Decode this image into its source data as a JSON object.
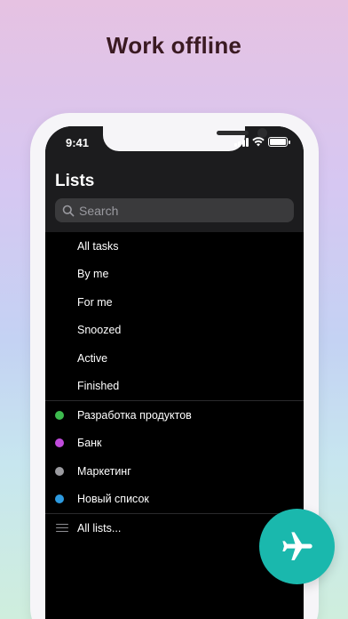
{
  "headline": "Work offline",
  "status_bar": {
    "time": "9:41"
  },
  "screen_title": "Lists",
  "search": {
    "placeholder": "Search"
  },
  "filters": [
    {
      "label": "All tasks"
    },
    {
      "label": "By me"
    },
    {
      "label": "For me"
    },
    {
      "label": "Snoozed"
    },
    {
      "label": "Active"
    },
    {
      "label": "Finished"
    }
  ],
  "lists": [
    {
      "label": "Разработка продуктов",
      "color": "#3dba4e"
    },
    {
      "label": "Банк",
      "color": "#c04bdc"
    },
    {
      "label": "Маркетинг",
      "color": "#9b9ba0"
    },
    {
      "label": "Новый список",
      "color": "#2d9ae0"
    }
  ],
  "all_lists_label": "All lists...",
  "fab_icon": "airplane-icon",
  "colors": {
    "accent": "#1ab8ad",
    "background": "#000000",
    "header": "#1c1c1e"
  }
}
